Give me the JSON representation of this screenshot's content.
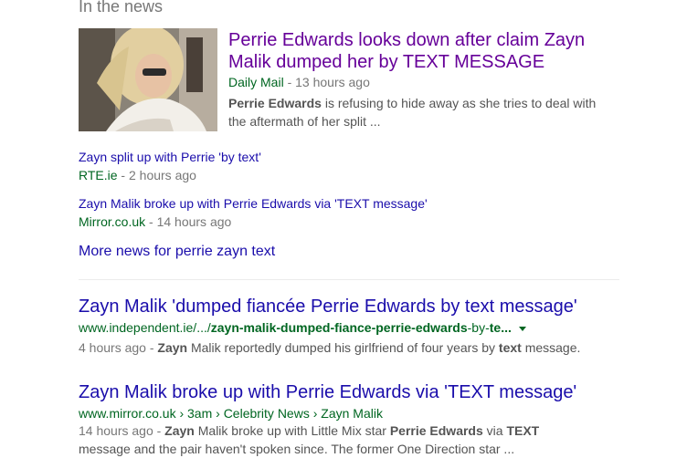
{
  "news_section": {
    "heading": "In the news",
    "lead": {
      "title": "Perrie Edwards looks down after claim Zayn Malik dumped her by TEXT MESSAGE",
      "source": "Daily Mail",
      "time": " - 13 hours ago",
      "snippet_bold": "Perrie Edwards",
      "snippet_rest": " is refusing to hide away as she tries to deal with the aftermath of her split ..."
    },
    "items": [
      {
        "title": "Zayn split up with Perrie 'by text'",
        "source": "RTE.ie",
        "time": " - 2 hours ago"
      },
      {
        "title": "Zayn Malik broke up with Perrie Edwards via 'TEXT message'",
        "source": "Mirror.co.uk",
        "time": " - 14 hours ago"
      }
    ],
    "more_link": "More news for perrie zayn text"
  },
  "results": [
    {
      "title": "Zayn Malik 'dumped fiancée Perrie Edwards by text message'",
      "url_prefix": "www.independent.ie/.../",
      "url_b1": "zayn-malik-dumped-fiance-",
      "url_b2": "perrie-edwards",
      "url_mid": "-by-",
      "url_b3": "te...",
      "snippet": {
        "time": "4 hours ago - ",
        "b1": "Zayn",
        "t1": " Malik reportedly dumped his girlfriend of four years by ",
        "b2": "text",
        "t2": " message."
      }
    },
    {
      "title": "Zayn Malik broke up with Perrie Edwards via 'TEXT message'",
      "breadcrumb": "www.mirror.co.uk › 3am › Celebrity News › Zayn Malik",
      "snippet": {
        "time": "14 hours ago - ",
        "b1": "Zayn",
        "t1": " Malik broke up with Little Mix star ",
        "b2": "Perrie Edwards",
        "t2": " via ",
        "b3": "TEXT",
        "line2": "message and the pair haven't spoken since. The former One Direction star ..."
      }
    }
  ],
  "colors": {
    "link": "#1a0dab",
    "visited": "#660099",
    "url": "#006621",
    "text": "#545454"
  }
}
